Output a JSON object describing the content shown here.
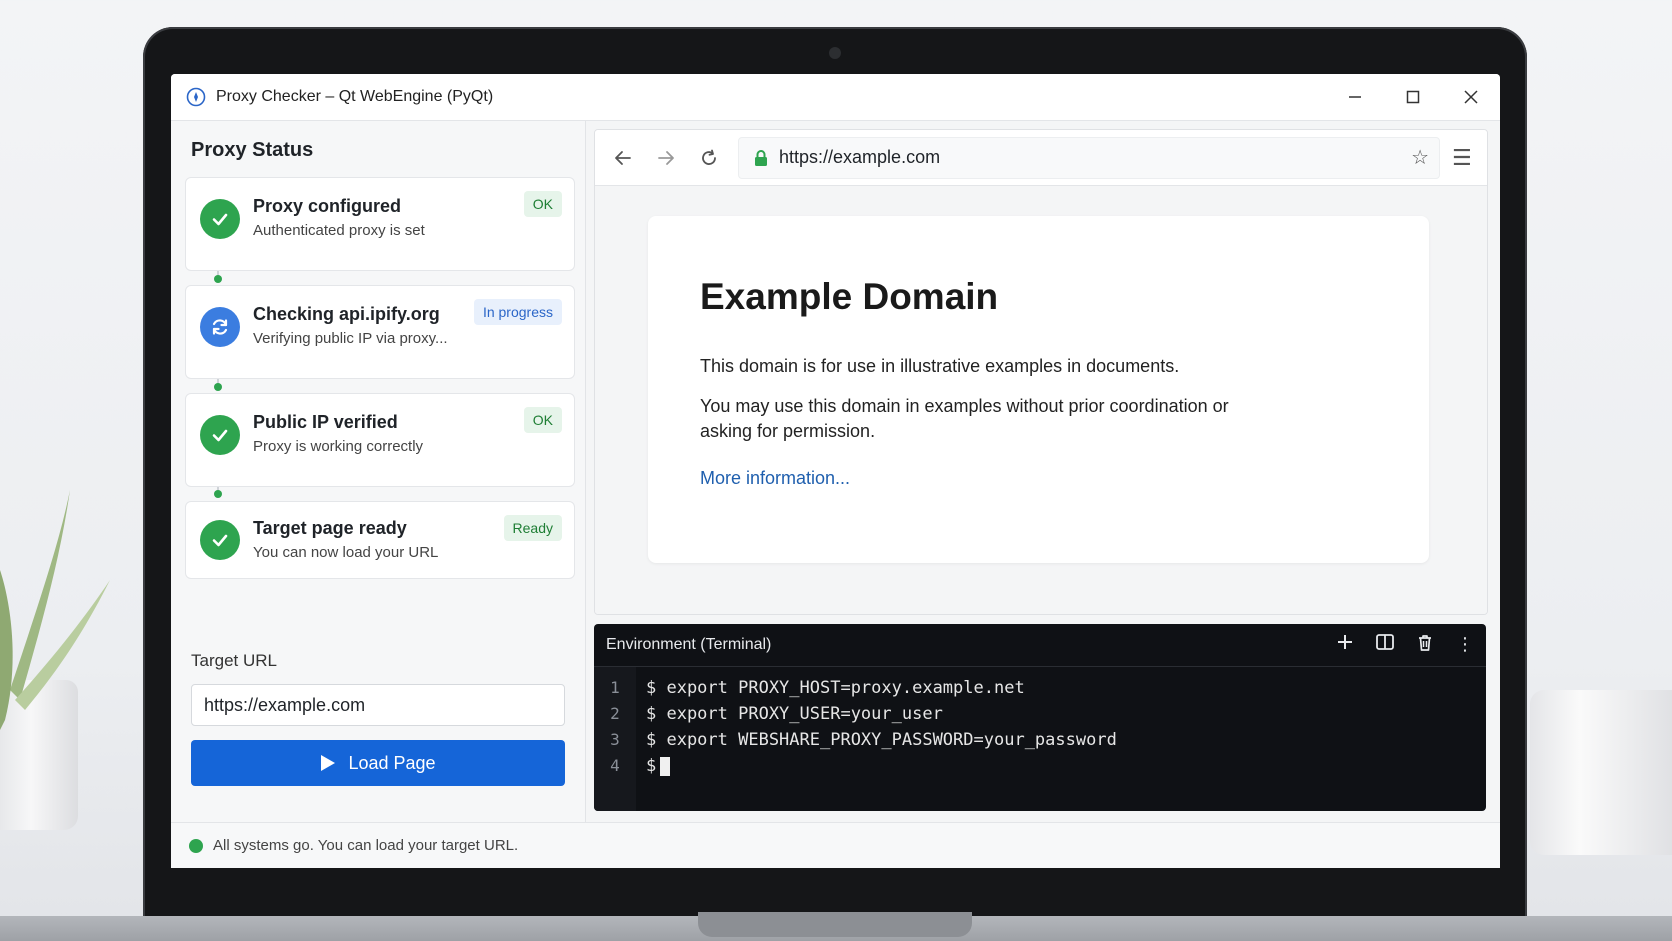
{
  "window": {
    "title": "Proxy Checker – Qt WebEngine (PyQt)"
  },
  "sidebar": {
    "title": "Proxy Status",
    "steps": [
      {
        "title": "Proxy configured",
        "subtitle": "Authenticated proxy is set",
        "badge": "OK",
        "state": "ok"
      },
      {
        "title": "Checking api.ipify.org",
        "subtitle": "Verifying public IP via proxy...",
        "badge": "In progress",
        "state": "in-progress"
      },
      {
        "title": "Public IP verified",
        "subtitle": "Proxy is working correctly",
        "badge": "OK",
        "state": "ok"
      },
      {
        "title": "Target page ready",
        "subtitle": "You can now load your URL",
        "badge": "Ready",
        "state": "ok"
      }
    ],
    "target_url_label": "Target URL",
    "target_url_value": "https://example.com",
    "load_button": "Load Page"
  },
  "browser": {
    "address": "https://example.com",
    "page": {
      "heading": "Example Domain",
      "paragraph1": "This domain is for use in illustrative examples in documents.",
      "paragraph2": "You may use this domain in examples without prior coordination or asking for permission.",
      "link": "More information..."
    }
  },
  "terminal": {
    "title": "Environment (Terminal)",
    "lines": [
      {
        "n": "1",
        "text": "$ export PROXY_HOST=proxy.example.net"
      },
      {
        "n": "2",
        "text": "$ export PROXY_USER=your_user"
      },
      {
        "n": "3",
        "text": "$ export WEBSHARE_PROXY_PASSWORD=your_password"
      },
      {
        "n": "4",
        "text": "$"
      }
    ]
  },
  "status": {
    "text": "All systems go. You can load your target URL."
  },
  "colors": {
    "ok": "#2ea44f",
    "progress": "#3b7de0",
    "primary_button": "#1565d8",
    "terminal_bg": "#0f1115"
  }
}
